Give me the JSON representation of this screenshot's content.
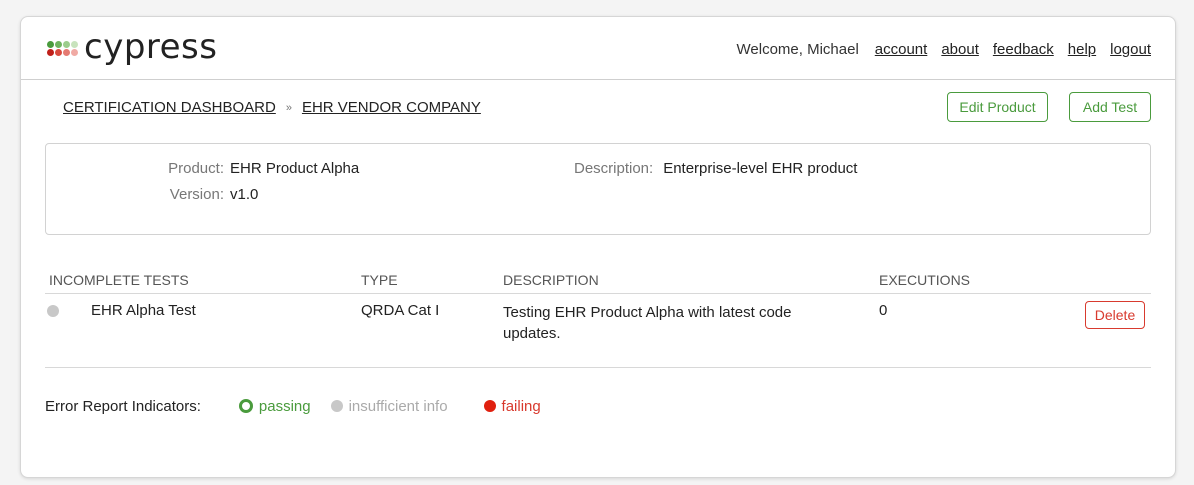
{
  "header": {
    "logo_text": "cypress",
    "logo_dot_colors": [
      "#4a9b3d",
      "#8cc67a",
      "#b9dcae",
      "#d8ecd2",
      "#c0201a",
      "#e0584a",
      "#e8807a",
      "#f0b0aa"
    ],
    "welcome": "Welcome, Michael",
    "nav": [
      "account",
      "about",
      "feedback",
      "help",
      "logout"
    ]
  },
  "breadcrumb": {
    "items": [
      "CERTIFICATION DASHBOARD",
      "EHR VENDOR COMPANY"
    ],
    "separator": "»"
  },
  "actions": {
    "edit_product": "Edit Product",
    "add_test": "Add Test"
  },
  "product": {
    "product_label": "Product:",
    "product_value": "EHR Product Alpha",
    "version_label": "Version:",
    "version_value": "v1.0",
    "description_label": "Description:",
    "description_value": "Enterprise-level EHR product"
  },
  "table": {
    "headers": [
      "INCOMPLETE TESTS",
      "TYPE",
      "DESCRIPTION",
      "EXECUTIONS"
    ],
    "rows": [
      {
        "name": "EHR Alpha Test",
        "type": "QRDA Cat I",
        "description": "Testing EHR Product Alpha with latest code updates.",
        "executions": "0",
        "delete_label": "Delete"
      }
    ]
  },
  "legend": {
    "title": "Error Report Indicators:",
    "passing": "passing",
    "insufficient": "insufficient info",
    "failing": "failing"
  },
  "colors": {
    "accent_green": "#4a9b3d",
    "danger_red": "#d83a2e",
    "neutral_gray": "#c8c8c8"
  }
}
